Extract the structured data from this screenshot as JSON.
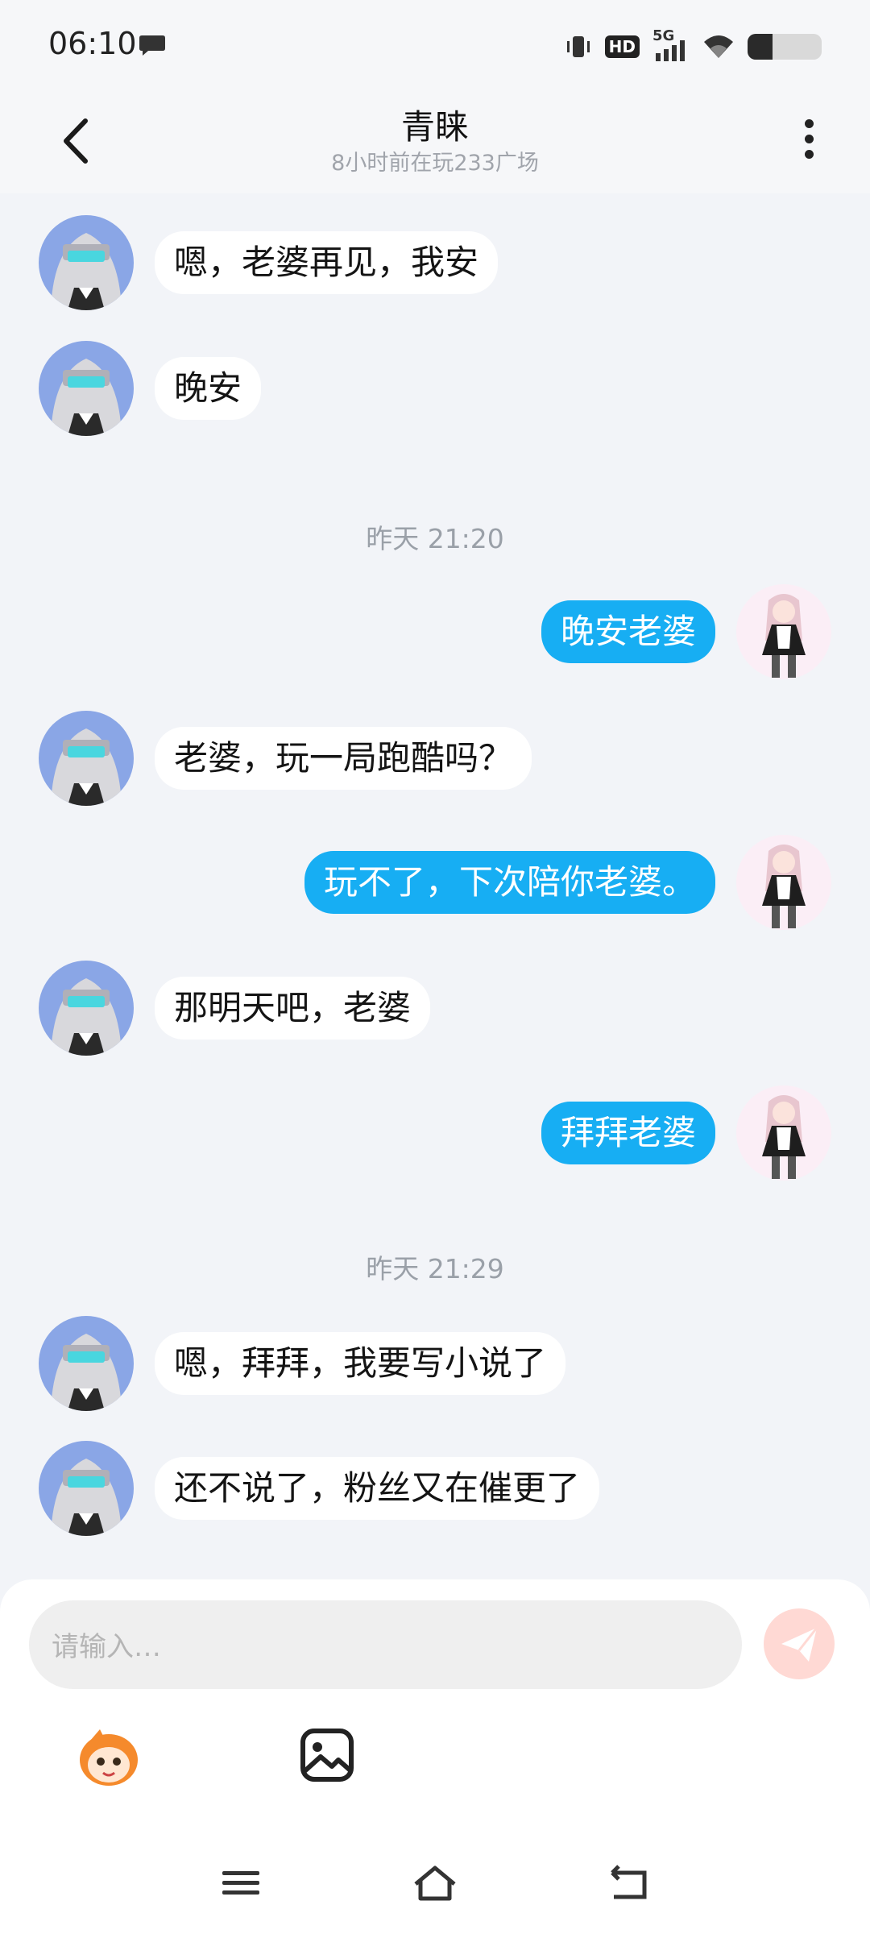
{
  "status_bar": {
    "time": "06:10",
    "network": "5G",
    "hd": "HD",
    "battery_level": 0.34
  },
  "header": {
    "title": "青睐",
    "subtitle": "8小时前在玩233广场"
  },
  "messages": [
    {
      "side": "in",
      "text": "嗯，老婆再见，我安"
    },
    {
      "side": "in",
      "text": "晚安"
    },
    {
      "side": "time",
      "text": "昨天 21:20"
    },
    {
      "side": "out",
      "text": "晚安老婆"
    },
    {
      "side": "in",
      "text": "老婆，玩一局跑酷吗？"
    },
    {
      "side": "out",
      "text": "玩不了，下次陪你老婆。"
    },
    {
      "side": "in",
      "text": "那明天吧，老婆"
    },
    {
      "side": "out",
      "text": "拜拜老婆"
    },
    {
      "side": "time",
      "text": "昨天 21:29"
    },
    {
      "side": "in",
      "text": "嗯，拜拜，我要写小说了"
    },
    {
      "side": "in",
      "text": "还不说了，粉丝又在催更了"
    }
  ],
  "composer": {
    "placeholder": "请输入…",
    "send_icon": "send-icon",
    "emoji_icon": "mascot-emoji-icon",
    "image_icon": "image-icon"
  },
  "colors": {
    "outgoing_bubble": "#17aef3",
    "incoming_bubble": "#ffffff",
    "background": "#f2f4f8",
    "send_button": "#ffd9d4"
  }
}
